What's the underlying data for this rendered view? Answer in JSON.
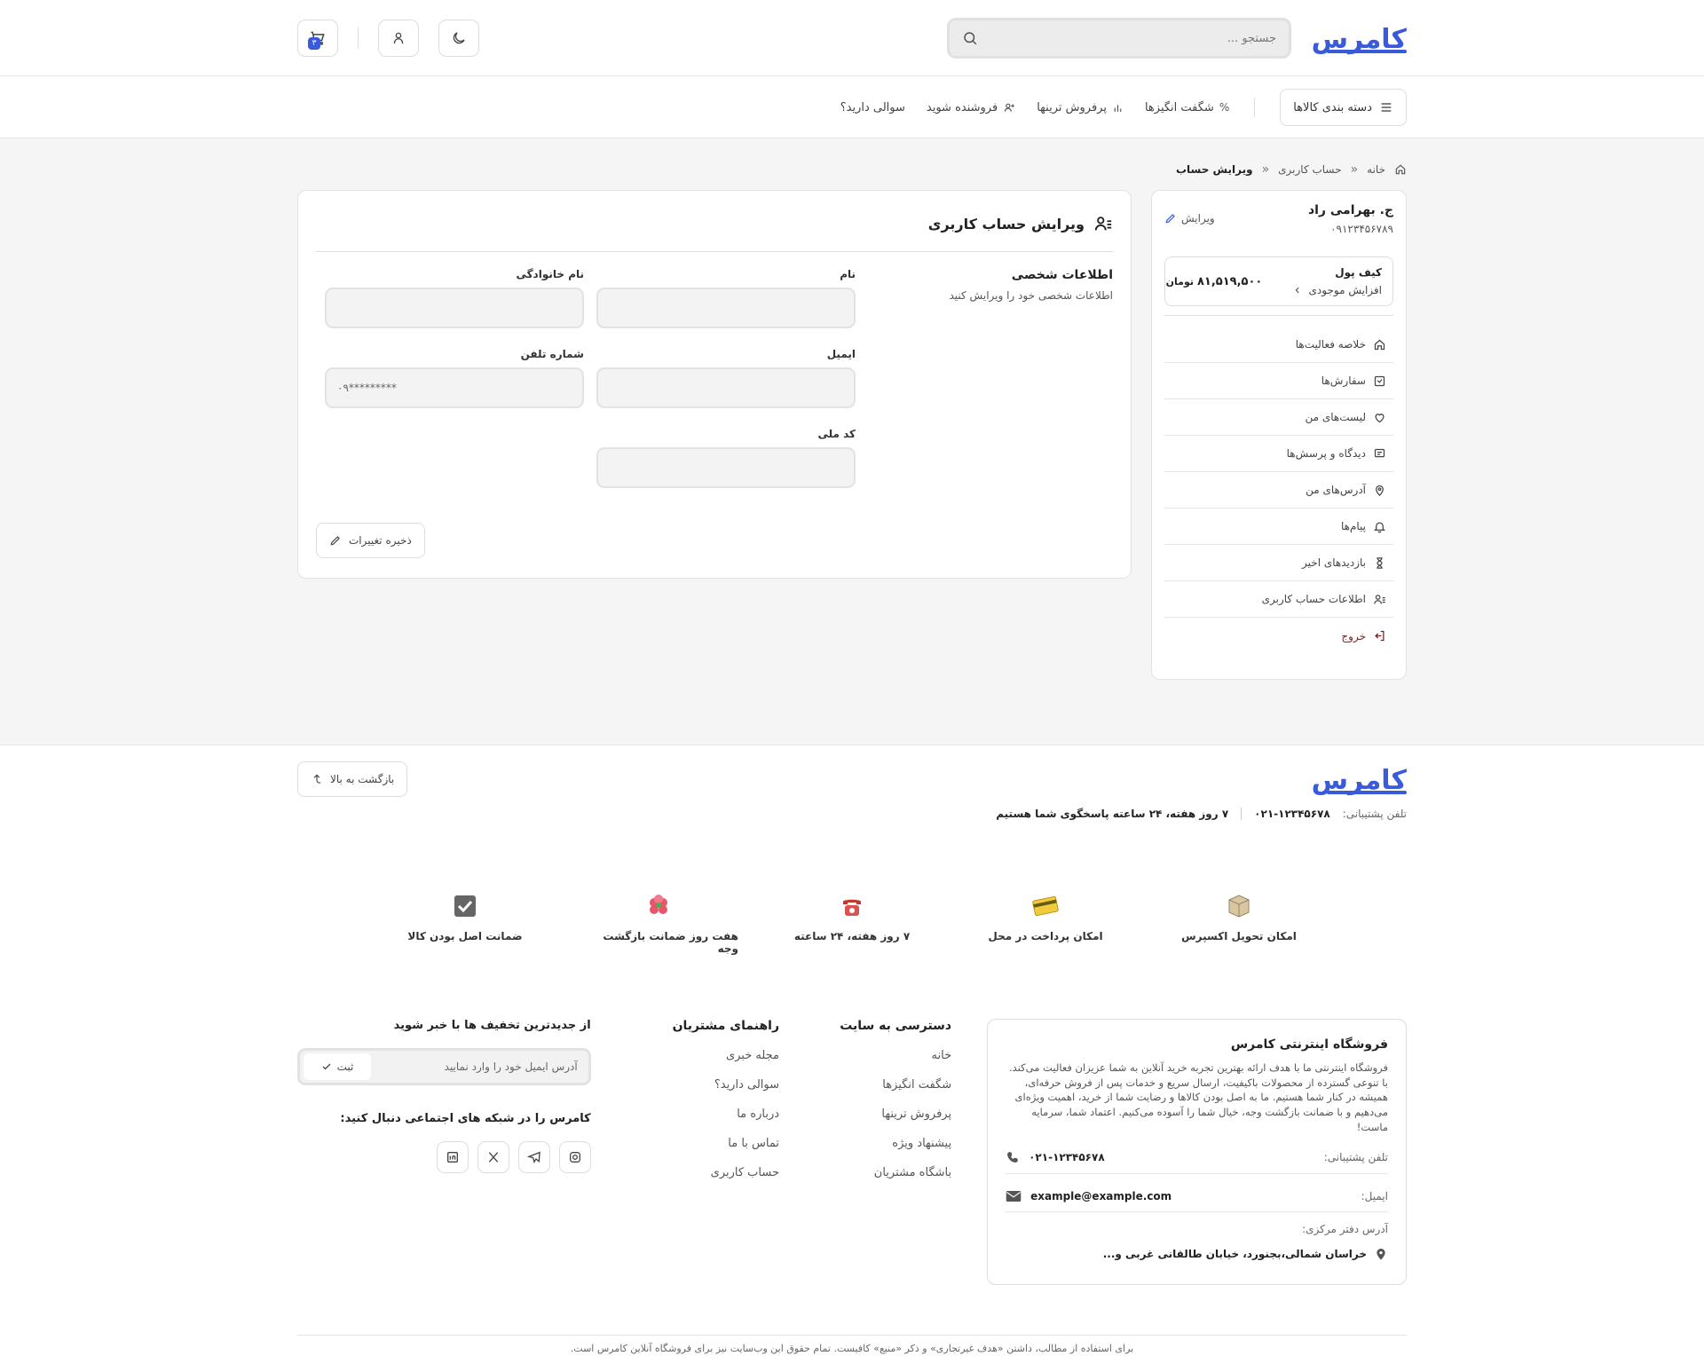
{
  "header": {
    "logo": "کامرس",
    "search_placeholder": "جستجو ...",
    "cart_count": "۳"
  },
  "nav": {
    "categories_label": "دسته بندی کالاها",
    "links": [
      "شگفت انگیزها",
      "پرفروش ترینها",
      "فروشنده شوید",
      "سوالی دارید؟"
    ]
  },
  "breadcrumb": {
    "home": "خانه",
    "account": "حساب کاربری",
    "current": "ویرایش حساب"
  },
  "sidebar": {
    "user_name": "ج. بهرامی راد",
    "user_phone": "۰۹۱۲۳۴۵۶۷۸۹",
    "edit_label": "ویرایش",
    "wallet_title": "کیف پول",
    "wallet_increase": "افزایش موجودی",
    "wallet_amount": "۸۱,۵۱۹,۵۰۰",
    "wallet_unit": "تومان",
    "menu": [
      "خلاصه فعالیت‌ها",
      "سفارش‌ها",
      "لیست‌های من",
      "دیدگاه و پرسش‌ها",
      "آدرس‌های من",
      "پیام‌ها",
      "بازدیدهای اخیر",
      "اطلاعات حساب کاربری"
    ],
    "logout": "خروج"
  },
  "form": {
    "title": "ویرایش حساب کاربری",
    "section_title": "اطلاعات شخصی",
    "section_sub": "اطلاعات شخصی خود را ویرایش کنید",
    "fields": {
      "first_name": {
        "label": "نام",
        "value": ""
      },
      "last_name": {
        "label": "نام خانوادگی",
        "value": ""
      },
      "email": {
        "label": "ایمیل",
        "value": ""
      },
      "phone": {
        "label": "شماره تلفن",
        "value": "۰۹*********"
      },
      "national_code": {
        "label": "کد ملی",
        "value": ""
      }
    },
    "save_label": "ذخیره تغییرات"
  },
  "footer": {
    "logo": "کامرس",
    "back_to_top": "بازگشت به بالا",
    "support_label": "تلفن پشتیبانی:",
    "support_phone": "۰۲۱-۱۲۳۴۵۶۷۸",
    "support_hours": "۷ روز هفته، ۲۴ ساعته پاسخگوی شما هستیم",
    "features": [
      "امکان تحویل اکسپرس",
      "امکان پرداخت در محل",
      "۷ روز هفته، ۲۴ ساعته",
      "هفت روز ضمانت بازگشت وجه",
      "ضمانت اصل بودن کالا"
    ],
    "store_title": "فروشگاه اینترنتی کامرس",
    "store_desc": "فروشگاه اینترنتی ما با هدف ارائه بهترین تجربه خرید آنلاین به شما عزیزان فعالیت می‌کند. با تنوعی گسترده از محصولات باکیفیت، ارسال سریع و خدمات پس از فروش حرفه‌ای، همیشه در کنار شما هستیم. ما به اصل بودن کالاها و رضایت شما از خرید، اهمیت ویژه‌ای می‌دهیم و با ضمانت بازگشت وجه، خیال شما را آسوده می‌کنیم. اعتماد شما، سرمایه ماست!",
    "contact_phone_label": "تلفن پشتیبانی:",
    "contact_phone": "۰۲۱-۱۲۳۴۵۶۷۸",
    "contact_email_label": "ایمیل:",
    "contact_email": "example@example.com",
    "address_label": "آدرس دفتر مرکزی:",
    "address": "خراسان شمالی،بجنورد، خیابان طالقانی غربی و...",
    "col1_title": "دسترسی به سایت",
    "col1_links": [
      "خانه",
      "شگفت انگیزها",
      "پرفروش ترینها",
      "پیشنهاد ویژه",
      "باشگاه مشتریان"
    ],
    "col2_title": "راهنمای مشتریان",
    "col2_links": [
      "مجله خبری",
      "سوالی دارید؟",
      "درباره ما",
      "تماس با ما",
      "حساب کاربری"
    ],
    "newsletter_title": "از جدیدترین تخفیف ها با خبر شوید",
    "newsletter_placeholder": "آدرس ایمیل خود را وارد نمایید",
    "newsletter_button": "ثبت",
    "social_title": "کامرس را در شبکه های اجتماعی دنبال کنید:",
    "copyright": "برای استفاده از مطالب، داشتن «هدف غیرتجاری» و ذکر «منبع» کافیست. تمام حقوق این وب‌سایت نیز برای فروشگاه آنلاین کامرس است."
  }
}
